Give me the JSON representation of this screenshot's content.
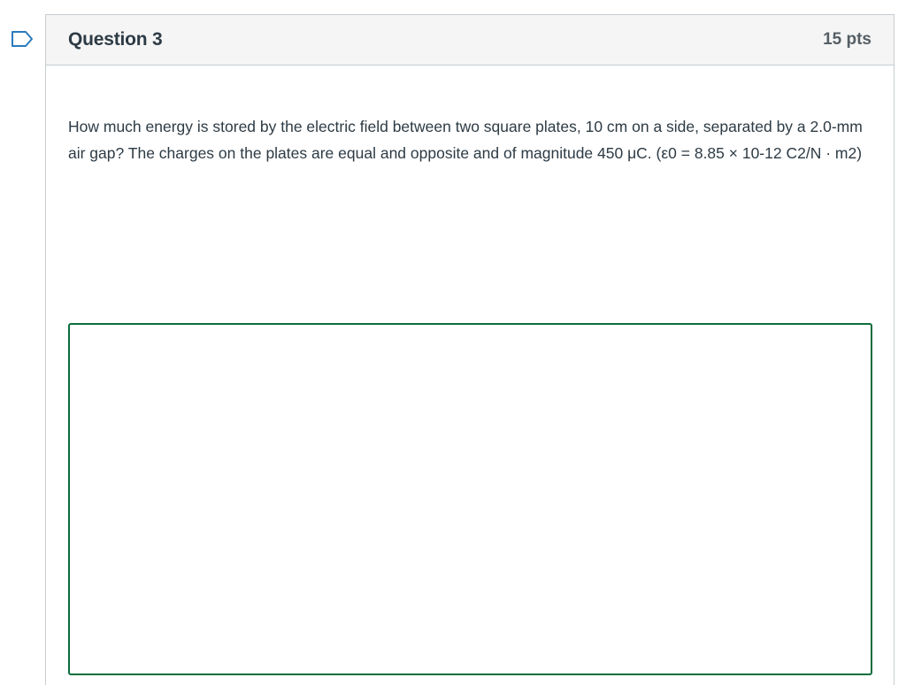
{
  "question": {
    "flag_icon": "bookmark-flag-icon",
    "title": "Question 3",
    "points": "15 pts",
    "text": "How much energy is stored by the electric field between two square plates, 10 cm on a side, separated by a 2.0-mm air gap? The charges on the plates are equal and opposite and of magnitude 450 μC.  (ε0 = 8.85 × 10-12 C2/N · m2)",
    "answer": {
      "value": "",
      "border_color": "#0b6e3d"
    }
  }
}
